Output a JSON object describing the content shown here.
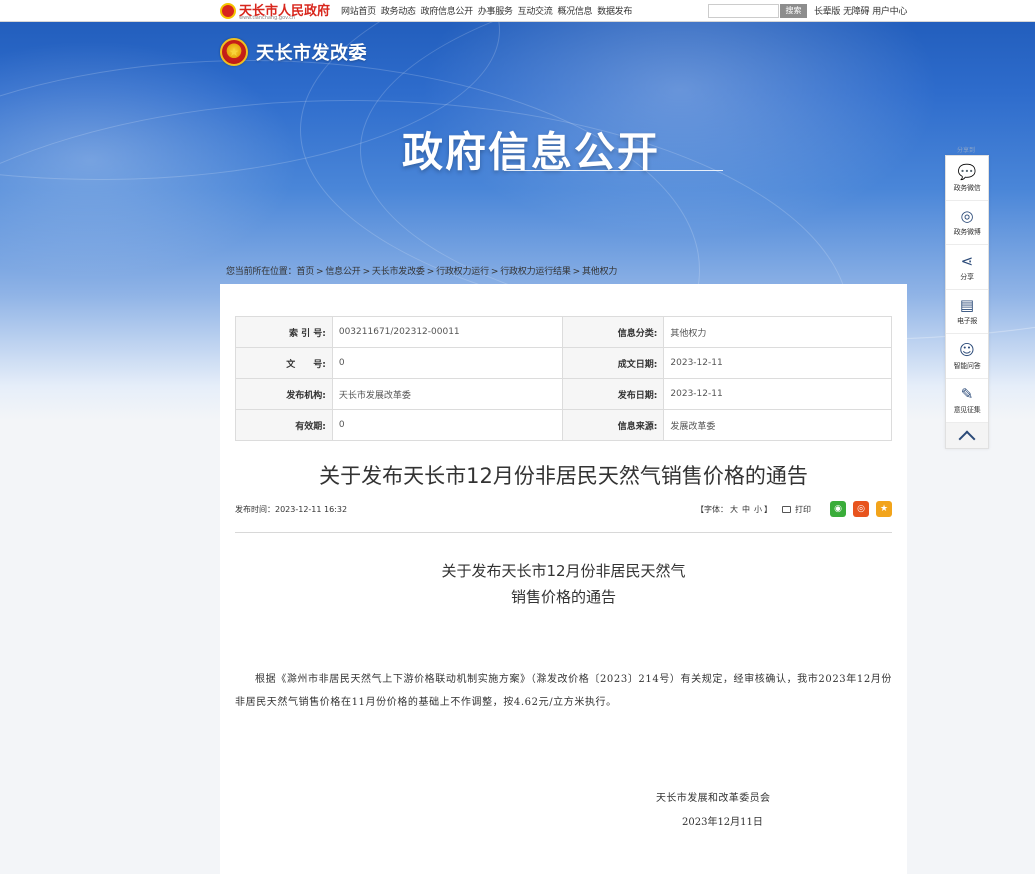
{
  "topbar": {
    "logo_name": "天长市人民政府",
    "logo_domain": "www.tianchang.gov.cn",
    "nav": [
      "网站首页",
      "政务动态",
      "政府信息公开",
      "办事服务",
      "互动交流",
      "概况信息",
      "数据发布"
    ],
    "search_button": "搜索",
    "links": [
      "长辈版",
      "无障碍",
      "用户中心"
    ]
  },
  "site": {
    "title": "天长市发改委",
    "hero_title": "政府信息公开"
  },
  "breadcrumb": {
    "prefix": "您当前所在位置：",
    "items": [
      "首页",
      "信息公开",
      "天长市发改委",
      "行政权力运行",
      "行政权力运行结果",
      "其他权力"
    ]
  },
  "meta": {
    "index_label": "索 引 号:",
    "index_value": "003211671/202312-00011",
    "category_label": "信息分类:",
    "category_value": "其他权力",
    "docno_label": "文　　号:",
    "docno_value": "0",
    "created_label": "成文日期:",
    "created_value": "2023-12-11",
    "org_label": "发布机构:",
    "org_value": "天长市发展改革委",
    "published_label": "发布日期:",
    "published_value": "2023-12-11",
    "validity_label": "有效期:",
    "validity_value": "0",
    "source_label": "信息来源:",
    "source_value": "发展改革委"
  },
  "article": {
    "title": "关于发布天长市12月份非居民天然气销售价格的通告",
    "pubtime": "发布时间：2023-12-11 16:32",
    "fontsize_prefix": "【字体：",
    "fontsize_big": "大",
    "fontsize_mid": "中",
    "fontsize_small": "小",
    "fontsize_suffix": "】",
    "print": "打印",
    "subtitle_line1": "关于发布天长市12月份非居民天然气",
    "subtitle_line2": "销售价格的通告",
    "body": "根据《滁州市非居民天然气上下游价格联动机制实施方案》（滁发改价格〔2023〕214号）有关规定，经审核确认，我市2023年12月份非居民天然气销售价格在11月份价格的基础上不作调整，按4.62元/立方米执行。",
    "signer": "天长市发展和改革委员会",
    "sign_date": "2023年12月11日"
  },
  "floatbar": {
    "top_label": "分享到",
    "items": [
      {
        "label": "政务微信",
        "icon": "wechat-icon"
      },
      {
        "label": "政务微博",
        "icon": "weibo-icon"
      },
      {
        "label": "分享",
        "icon": "share-icon"
      },
      {
        "label": "电子报",
        "icon": "newspaper-icon"
      },
      {
        "label": "智能问答",
        "icon": "robot-icon"
      },
      {
        "label": "意见征集",
        "icon": "feedback-icon"
      }
    ]
  }
}
